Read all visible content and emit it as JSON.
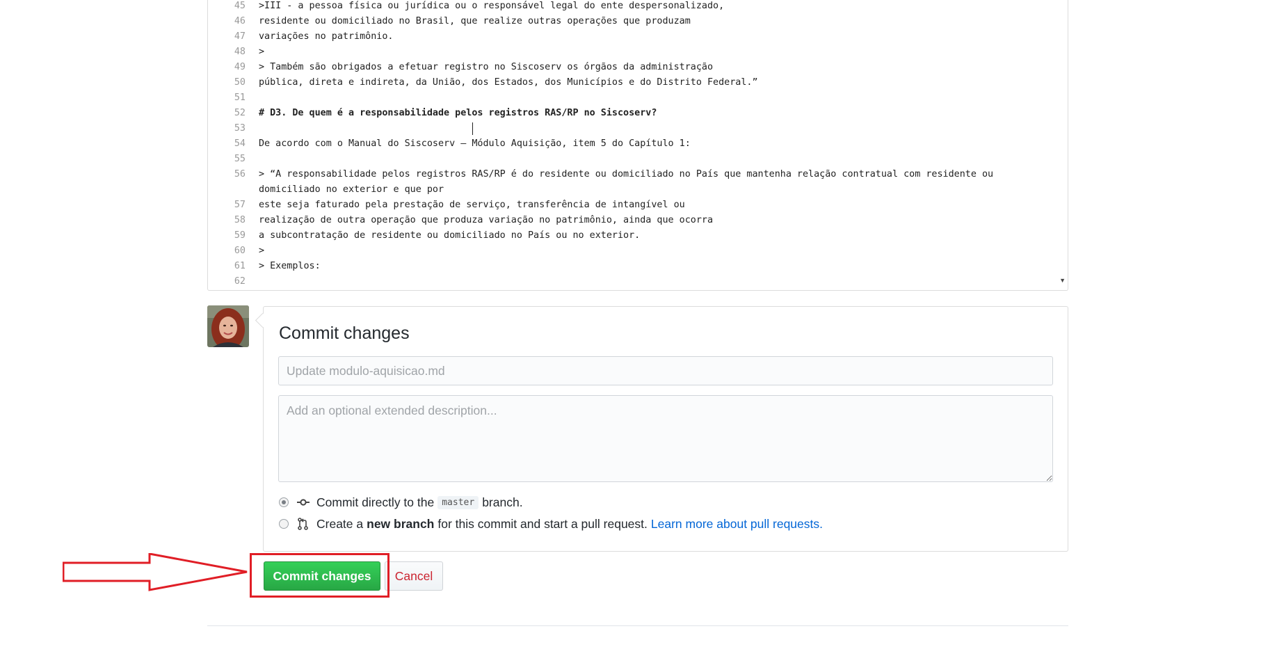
{
  "editor": {
    "lines": [
      {
        "n": "45",
        "text": ">III - a pessoa física ou jurídica ou o responsável legal do ente despersonalizado,"
      },
      {
        "n": "46",
        "text": "residente ou domiciliado no Brasil, que realize outras operações que produzam"
      },
      {
        "n": "47",
        "text": "variações no patrimônio."
      },
      {
        "n": "48",
        "text": ">"
      },
      {
        "n": "49",
        "text": "> Também são obrigados a efetuar registro no Siscoserv os órgãos da administração"
      },
      {
        "n": "50",
        "text": "pública, direta e indireta, da União, dos Estados, dos Municípios e do Distrito Federal.”"
      },
      {
        "n": "51",
        "text": ""
      },
      {
        "n": "52",
        "text": "# D3. De quem é a responsabilidade pelos registros RAS/RP no Siscoserv?"
      },
      {
        "n": "53",
        "text": ""
      },
      {
        "n": "54",
        "text": "De acordo com o Manual do Siscoserv – Módulo Aquisição, item 5 do Capítulo 1:"
      },
      {
        "n": "55",
        "text": ""
      },
      {
        "n": "56",
        "text": "> “A responsabilidade pelos registros RAS/RP é do residente ou domiciliado no País que mantenha relação contratual com residente ou"
      },
      {
        "n": "",
        "text": "domiciliado no exterior e que por"
      },
      {
        "n": "57",
        "text": "este seja faturado pela prestação de serviço, transferência de intangível ou"
      },
      {
        "n": "58",
        "text": "realização de outra operação que produza variação no patrimônio, ainda que ocorra"
      },
      {
        "n": "59",
        "text": "a subcontratação de residente ou domiciliado no País ou no exterior."
      },
      {
        "n": "60",
        "text": ">"
      },
      {
        "n": "61",
        "text": "> Exemplos:"
      },
      {
        "n": "62",
        "text": ""
      }
    ]
  },
  "commit": {
    "title": "Commit changes",
    "summary_placeholder": "Update modulo-aquisicao.md",
    "description_placeholder": "Add an optional extended description...",
    "option_direct": {
      "prefix": "Commit directly to the",
      "branch": "master",
      "suffix": "branch.",
      "checked": true
    },
    "option_new_branch": {
      "prefix": "Create a",
      "bold": "new branch",
      "suffix": "for this commit and start a pull request.",
      "link": "Learn more about pull requests.",
      "checked": false
    }
  },
  "buttons": {
    "commit_label": "Commit changes",
    "cancel_label": "Cancel"
  },
  "colors": {
    "commit_green": "#2cbe4e",
    "cancel_red": "#cb2431",
    "link_blue": "#0366d6",
    "annotation_red": "#e01e26"
  },
  "icons": {
    "commit": "git-commit-icon",
    "branch": "git-pull-request-icon",
    "annotation": "red-arrow-annotation"
  }
}
